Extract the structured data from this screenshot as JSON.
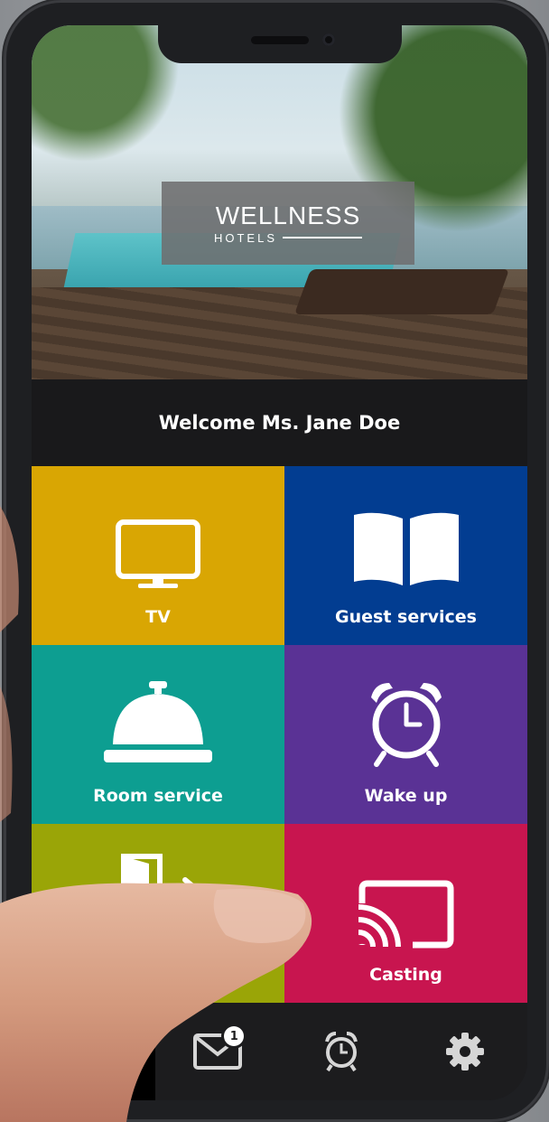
{
  "hotel": {
    "logo_line1": "WELLNESS",
    "logo_line2": "HOTELS"
  },
  "welcome_text": "Welcome Ms. Jane Doe",
  "tiles": [
    {
      "label": "TV",
      "color": "#d9a603",
      "icon": "tv-icon"
    },
    {
      "label": "Guest services",
      "color": "#023d91",
      "icon": "book-icon"
    },
    {
      "label": "Room service",
      "color": "#0d9e91",
      "icon": "service-bell-icon"
    },
    {
      "label": "Wake up",
      "color": "#5a3295",
      "icon": "alarm-clock-icon"
    },
    {
      "label": "",
      "color": "#9aa507",
      "icon": "exit-door-icon"
    },
    {
      "label": "Casting",
      "color": "#c8154f",
      "icon": "cast-icon"
    }
  ],
  "tab_bar": {
    "items": [
      {
        "icon": "menu-icon",
        "active": true
      },
      {
        "icon": "mail-icon",
        "badge": "1"
      },
      {
        "icon": "alarm-icon"
      },
      {
        "icon": "gear-icon"
      }
    ]
  }
}
